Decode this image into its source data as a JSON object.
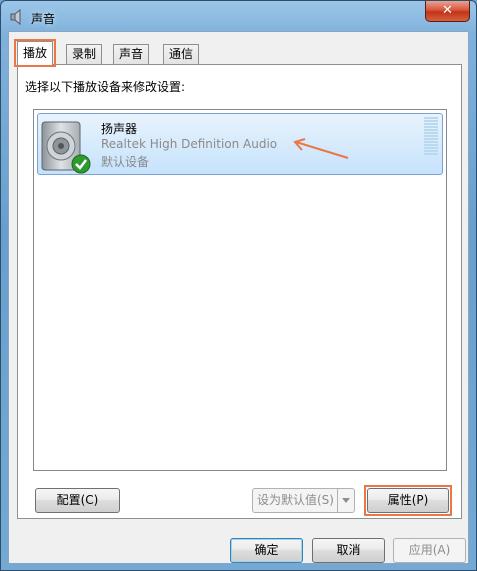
{
  "window": {
    "title": "声音",
    "close_label": "✕"
  },
  "tabs": [
    {
      "label": "播放",
      "active": true
    },
    {
      "label": "录制",
      "active": false
    },
    {
      "label": "声音",
      "active": false
    },
    {
      "label": "通信",
      "active": false
    }
  ],
  "playback": {
    "instruction": "选择以下播放设备来修改设置:",
    "devices": [
      {
        "name": "扬声器",
        "description": "Realtek High Definition Audio",
        "status": "默认设备"
      }
    ],
    "configure_label": "配置(C)",
    "set_default_label": "设为默认值(S)",
    "properties_label": "属性(P)"
  },
  "footer": {
    "ok_label": "确定",
    "cancel_label": "取消",
    "apply_label": "应用(A)"
  },
  "colors": {
    "annotation": "#e97845",
    "selection": "#c6e2fc"
  }
}
